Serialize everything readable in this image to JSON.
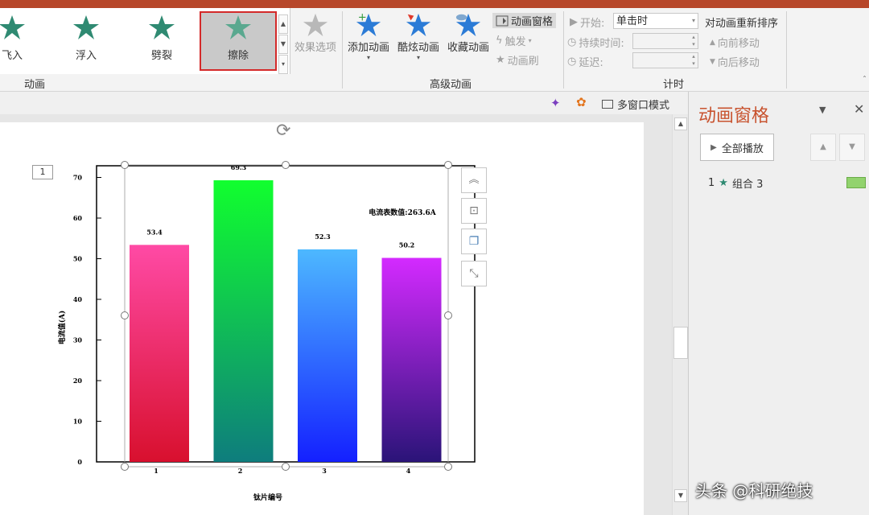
{
  "ribbon": {
    "gallery": {
      "items": [
        {
          "label": "飞入",
          "icon": "fly-in-star-icon"
        },
        {
          "label": "浮入",
          "icon": "float-in-star-icon"
        },
        {
          "label": "劈裂",
          "icon": "split-star-icon"
        },
        {
          "label": "擦除",
          "icon": "wipe-star-icon",
          "selected": true
        }
      ]
    },
    "effect_options": "效果选项",
    "group_animation": "动画",
    "add_animation": "添加动画",
    "cool_animation": "酷炫动画",
    "favorite_animation": "收藏动画",
    "animation_pane": "动画窗格",
    "trigger": "触发",
    "animation_painter": "动画刷",
    "group_advanced": "高级动画",
    "start_label": "开始:",
    "start_value": "单击时",
    "duration_label": "持续时间:",
    "delay_label": "延迟:",
    "group_timing": "计时",
    "reorder_title": "对动画重新排序",
    "move_earlier": "向前移动",
    "move_later": "向后移动"
  },
  "toolbar2": {
    "multiwindow": "多窗口模式"
  },
  "slide": {
    "number": "1"
  },
  "chart_data": {
    "type": "bar",
    "categories": [
      "1",
      "2",
      "3",
      "4"
    ],
    "values": [
      53.4,
      69.3,
      52.3,
      50.2
    ],
    "ylabel": "电流值(A)",
    "xlabel": "钛片编号",
    "ylim": [
      0,
      75
    ],
    "yticks": [
      0,
      10,
      20,
      30,
      40,
      50,
      60,
      70
    ],
    "annotation": "电流表数值:263.6A",
    "bar_gradients": [
      [
        "#ff4aa5",
        "#d8102e"
      ],
      [
        "#11ff2e",
        "#0e7d7d"
      ],
      [
        "#4db8ff",
        "#1420ff"
      ],
      [
        "#d42aff",
        "#2a1478"
      ]
    ]
  },
  "pane": {
    "title": "动画窗格",
    "play_all": "全部播放",
    "item": {
      "index": "1",
      "name": "组合 3"
    }
  },
  "watermark": "头条 @科研绝技"
}
